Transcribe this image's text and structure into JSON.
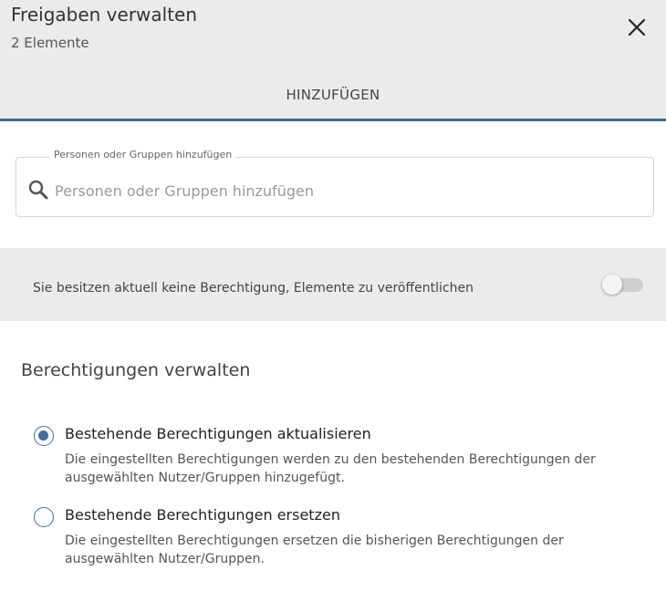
{
  "header": {
    "title": "Freigaben verwalten",
    "subtitle": "2 Elemente",
    "close_icon": "close-icon"
  },
  "tabs": [
    {
      "label": "HINZUFÜGEN",
      "active": true
    }
  ],
  "search": {
    "legend": "Personen oder Gruppen hinzufügen",
    "placeholder": "Personen oder Gruppen hinzufügen",
    "value": "",
    "icon": "search-icon"
  },
  "publish": {
    "text": "Sie besitzen aktuell keine Berechtigung, Elemente zu veröffentlichen",
    "enabled": false
  },
  "permissions": {
    "title": "Berechtigungen verwalten",
    "options": [
      {
        "label": "Bestehende Berechtigungen aktualisieren",
        "description": "Die eingestellten Berechtigungen werden zu den bestehenden Berechtigungen der ausgewählten Nutzer/Gruppen hinzugefügt.",
        "selected": true
      },
      {
        "label": "Bestehende Berechtigungen ersetzen",
        "description": "Die eingestellten Berechtigungen ersetzen die bisherigen Berechtigungen der ausgewählten Nutzer/Gruppen.",
        "selected": false
      }
    ]
  },
  "colors": {
    "accent": "#3f6e9a",
    "header_bg": "#ebebeb",
    "toggle_track": "#cfcfcf"
  }
}
